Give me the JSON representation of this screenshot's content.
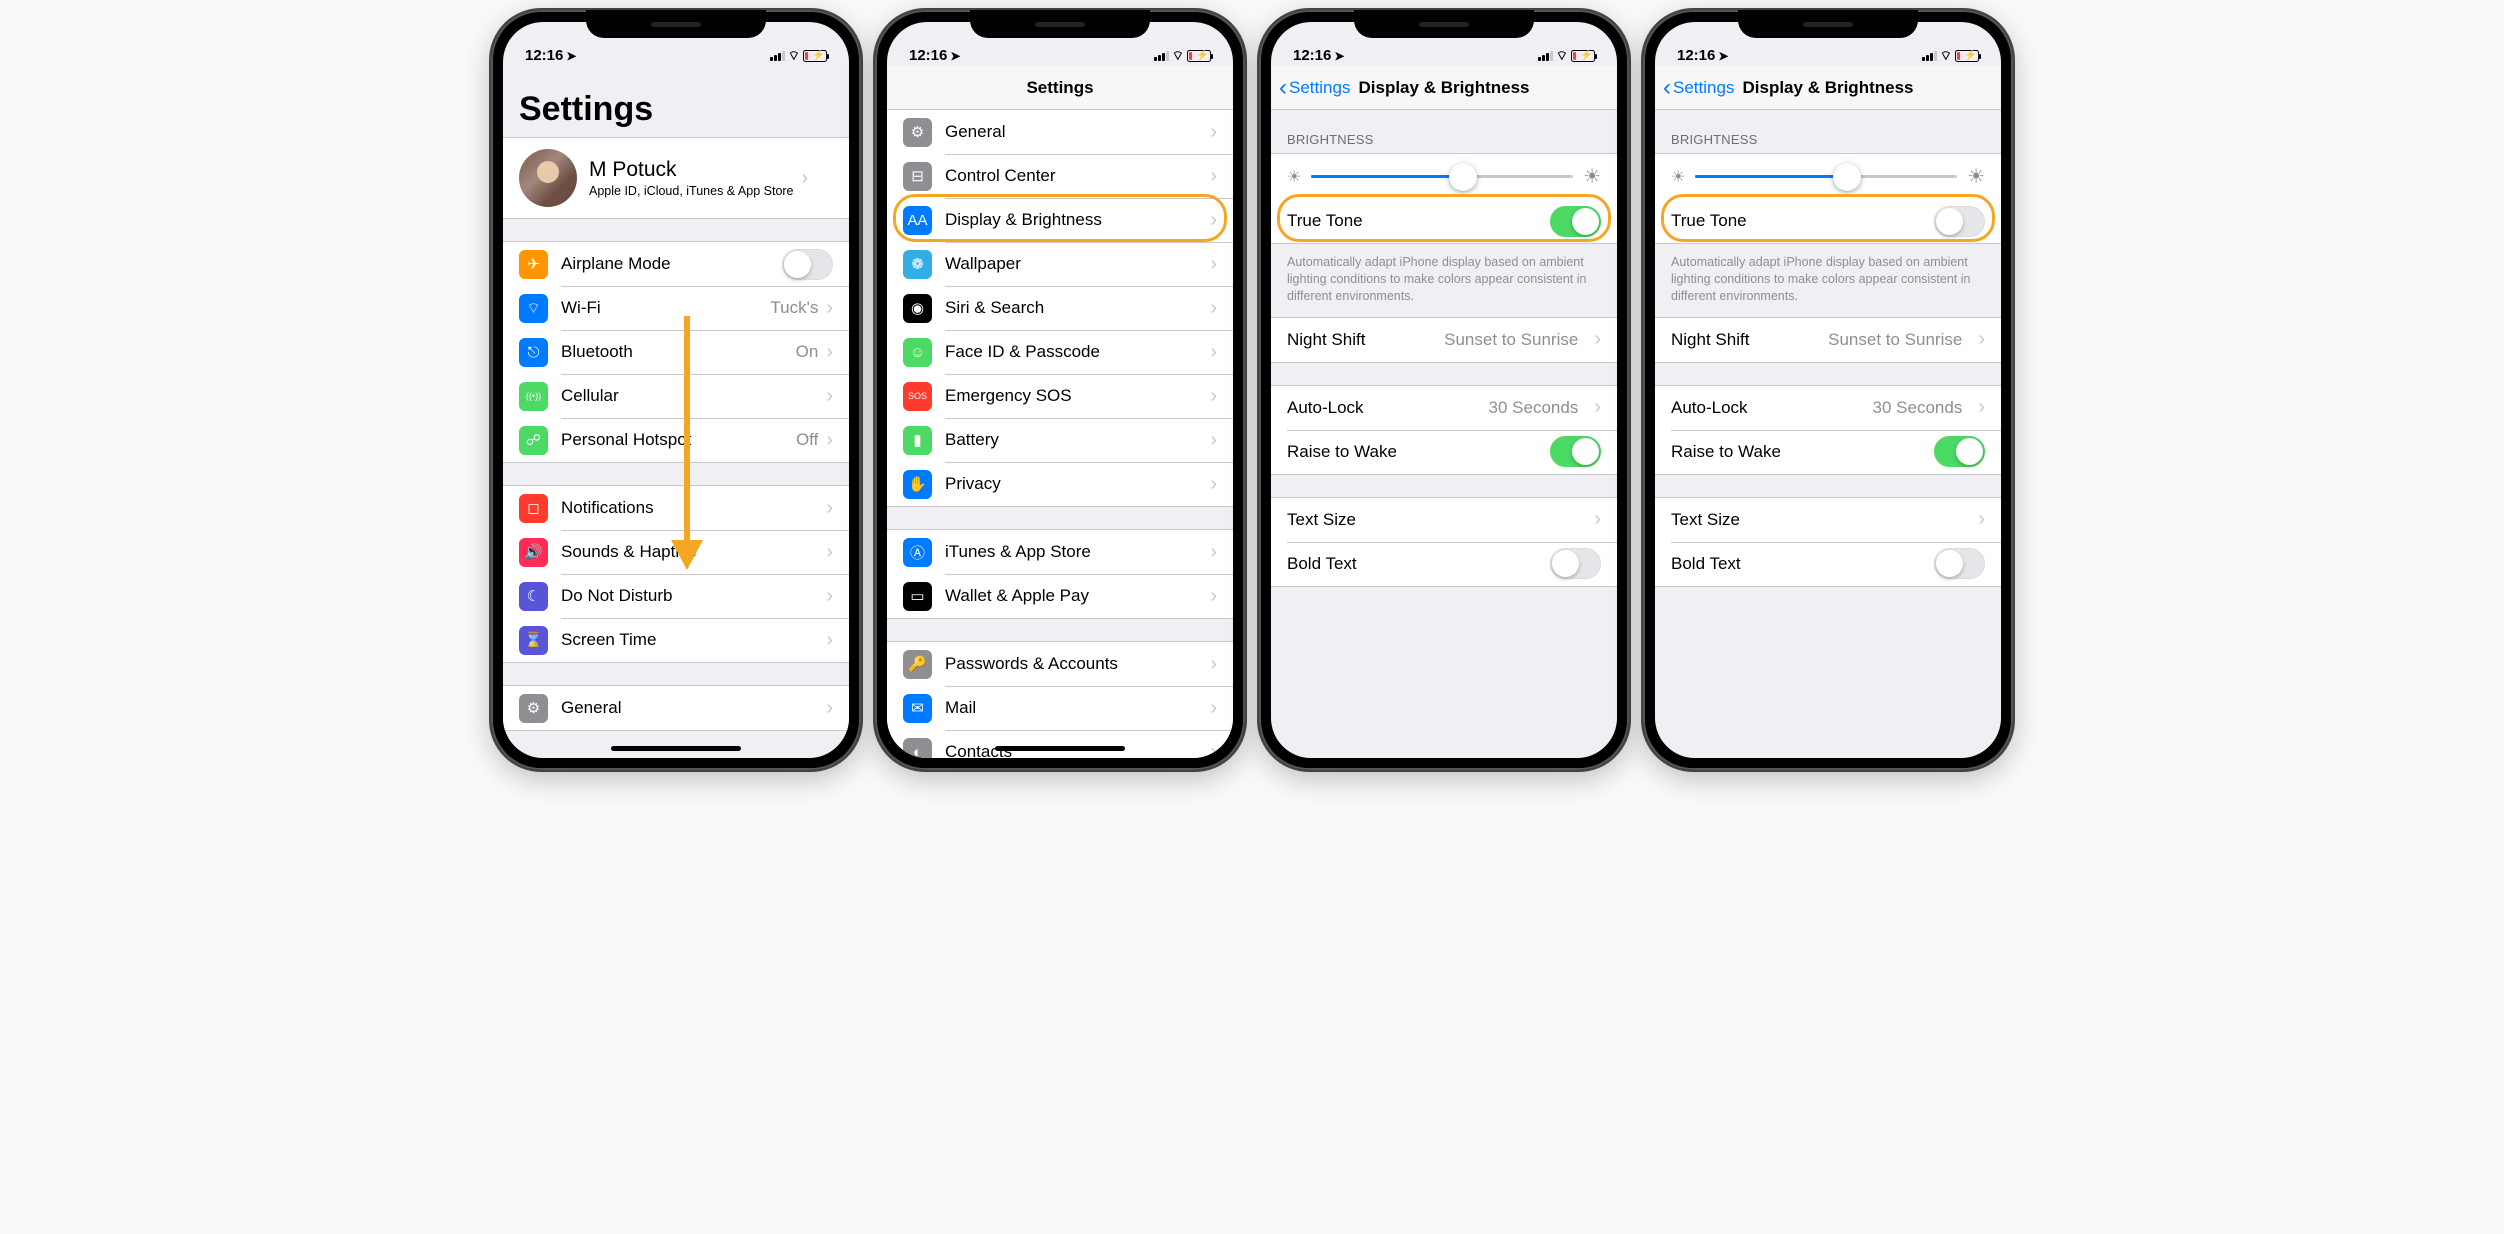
{
  "status": {
    "time": "12:16",
    "carrier_bars": 3
  },
  "colors": {
    "accent": "#f5a623",
    "ios_blue": "#007aff",
    "toggle_on": "#4cd964"
  },
  "screen1": {
    "title": "Settings",
    "profile": {
      "name": "M Potuck",
      "subtitle": "Apple ID, iCloud, iTunes & App Store"
    },
    "group1": [
      {
        "label": "Airplane Mode",
        "icon": "airplane-icon",
        "bg": "bg-orange",
        "glyph": "✈",
        "type": "toggle",
        "on": false
      },
      {
        "label": "Wi-Fi",
        "icon": "wifi-icon",
        "bg": "bg-blue",
        "glyph": "⌔",
        "value": "Tuck's"
      },
      {
        "label": "Bluetooth",
        "icon": "bluetooth-icon",
        "bg": "bg-blue",
        "glyph": "⎋",
        "value": "On"
      },
      {
        "label": "Cellular",
        "icon": "cellular-icon",
        "bg": "bg-green",
        "glyph": "((•))"
      },
      {
        "label": "Personal Hotspot",
        "icon": "hotspot-icon",
        "bg": "bg-green",
        "glyph": "☍",
        "value": "Off"
      }
    ],
    "group2": [
      {
        "label": "Notifications",
        "icon": "notifications-icon",
        "bg": "bg-red",
        "glyph": "◻"
      },
      {
        "label": "Sounds & Haptics",
        "icon": "sounds-icon",
        "bg": "bg-pink",
        "glyph": "🔊"
      },
      {
        "label": "Do Not Disturb",
        "icon": "dnd-icon",
        "bg": "bg-purple",
        "glyph": "☾"
      },
      {
        "label": "Screen Time",
        "icon": "screentime-icon",
        "bg": "bg-indigo",
        "glyph": "⌛"
      }
    ],
    "group3": [
      {
        "label": "General",
        "icon": "general-icon",
        "bg": "bg-gray",
        "glyph": "⚙"
      }
    ]
  },
  "screen2": {
    "title": "Settings",
    "items_a": [
      {
        "label": "General",
        "icon": "general-icon",
        "bg": "bg-gray",
        "glyph": "⚙"
      },
      {
        "label": "Control Center",
        "icon": "control-center-icon",
        "bg": "bg-gray",
        "glyph": "⊟"
      },
      {
        "label": "Display & Brightness",
        "icon": "display-icon",
        "bg": "bg-blue",
        "glyph": "AA",
        "highlight": true
      },
      {
        "label": "Wallpaper",
        "icon": "wallpaper-icon",
        "bg": "bg-teal",
        "glyph": "❁"
      },
      {
        "label": "Siri & Search",
        "icon": "siri-icon",
        "bg": "bg-black",
        "glyph": "◉"
      },
      {
        "label": "Face ID & Passcode",
        "icon": "faceid-icon",
        "bg": "bg-green",
        "glyph": "☺"
      },
      {
        "label": "Emergency SOS",
        "icon": "sos-icon",
        "bg": "bg-red",
        "glyph": "SOS"
      },
      {
        "label": "Battery",
        "icon": "battery-icon",
        "bg": "bg-green",
        "glyph": "▮"
      },
      {
        "label": "Privacy",
        "icon": "privacy-icon",
        "bg": "bg-blue",
        "glyph": "✋"
      }
    ],
    "items_b": [
      {
        "label": "iTunes & App Store",
        "icon": "appstore-icon",
        "bg": "bg-blue",
        "glyph": "Ⓐ"
      },
      {
        "label": "Wallet & Apple Pay",
        "icon": "wallet-icon",
        "bg": "bg-black",
        "glyph": "▭"
      }
    ],
    "items_c": [
      {
        "label": "Passwords & Accounts",
        "icon": "passwords-icon",
        "bg": "bg-gray",
        "glyph": "🔑"
      },
      {
        "label": "Mail",
        "icon": "mail-icon",
        "bg": "bg-blue",
        "glyph": "✉"
      },
      {
        "label": "Contacts",
        "icon": "contacts-icon",
        "bg": "bg-gray",
        "glyph": "◐"
      }
    ]
  },
  "screen3": {
    "back": "Settings",
    "title": "Display & Brightness",
    "brightness_header": "BRIGHTNESS",
    "brightness_pct": 58,
    "true_tone_label": "True Tone",
    "true_tone_on": true,
    "footer": "Automatically adapt iPhone display based on ambient lighting conditions to make colors appear consistent in different environments.",
    "night_shift_label": "Night Shift",
    "night_shift_value": "Sunset to Sunrise",
    "auto_lock_label": "Auto-Lock",
    "auto_lock_value": "30 Seconds",
    "raise_label": "Raise to Wake",
    "raise_on": true,
    "text_size_label": "Text Size",
    "bold_label": "Bold Text",
    "bold_on": false
  },
  "screen4": {
    "back": "Settings",
    "title": "Display & Brightness",
    "brightness_header": "BRIGHTNESS",
    "brightness_pct": 58,
    "true_tone_label": "True Tone",
    "true_tone_on": false,
    "footer": "Automatically adapt iPhone display based on ambient lighting conditions to make colors appear consistent in different environments.",
    "night_shift_label": "Night Shift",
    "night_shift_value": "Sunset to Sunrise",
    "auto_lock_label": "Auto-Lock",
    "auto_lock_value": "30 Seconds",
    "raise_label": "Raise to Wake",
    "raise_on": true,
    "text_size_label": "Text Size",
    "bold_label": "Bold Text",
    "bold_on": false
  }
}
